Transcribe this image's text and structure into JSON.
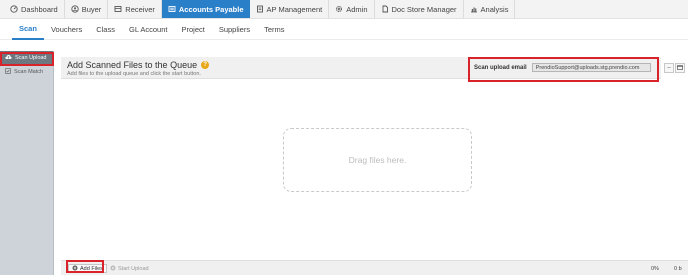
{
  "nav": {
    "items": [
      {
        "label": "Dashboard",
        "icon": "dashboard-icon"
      },
      {
        "label": "Buyer",
        "icon": "buyer-icon"
      },
      {
        "label": "Receiver",
        "icon": "receiver-icon"
      },
      {
        "label": "Accounts Payable",
        "icon": "accounts-payable-icon",
        "active": true
      },
      {
        "label": "AP Management",
        "icon": "ap-management-icon"
      },
      {
        "label": "Admin",
        "icon": "gear-icon"
      },
      {
        "label": "Doc Store Manager",
        "icon": "document-icon"
      },
      {
        "label": "Analysis",
        "icon": "chart-icon"
      }
    ]
  },
  "subnav": {
    "tabs": [
      {
        "label": "Scan",
        "active": true
      },
      {
        "label": "Vouchers"
      },
      {
        "label": "Class"
      },
      {
        "label": "GL Account"
      },
      {
        "label": "Project"
      },
      {
        "label": "Suppliers"
      },
      {
        "label": "Terms"
      }
    ]
  },
  "sidebar": {
    "items": [
      {
        "label": "Scan Upload",
        "icon": "cloud-upload-icon",
        "active": true
      },
      {
        "label": "Scan Match",
        "icon": "match-icon"
      }
    ]
  },
  "panel": {
    "title": "Add Scanned Files to the Queue",
    "help_icon": "?",
    "subtitle": "Add files to the upload queue and click the start button.",
    "email_label": "Scan upload email",
    "email_value": "PrendioSupport@uploads.stg.prendio.com",
    "drop_text": "Drag files here.",
    "add_files_label": "Add Files",
    "start_upload_label": "Start Upload",
    "progress": "0%",
    "size": "0 b"
  },
  "colors": {
    "accent": "#2a7fc9",
    "highlight": "#d8232a",
    "sidebar_bg": "#cdd3d9",
    "sidebar_active": "#6c7780"
  }
}
